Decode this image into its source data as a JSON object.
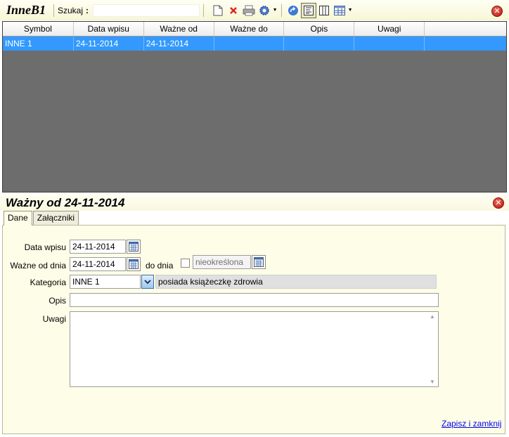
{
  "app": {
    "title": "InneB1"
  },
  "toolbar": {
    "search_label": "Szukaj",
    "search_colon": ":",
    "search_value": ""
  },
  "grid": {
    "columns": [
      "Symbol",
      "Data wpisu",
      "Ważne od",
      "Ważne do",
      "Opis",
      "Uwagi",
      ""
    ],
    "rows": [
      [
        "INNE 1",
        "24-11-2014",
        "24-11-2014",
        "",
        "",
        "",
        ""
      ]
    ]
  },
  "detail": {
    "title": "Ważny od 24-11-2014",
    "tabs": [
      {
        "label": "Dane",
        "active": true
      },
      {
        "label": "Załączniki",
        "active": false
      }
    ],
    "form": {
      "data_wpisu_label": "Data wpisu",
      "data_wpisu_value": "24-11-2014",
      "wazne_od_label": "Ważne od dnia",
      "wazne_od_value": "24-11-2014",
      "do_dnia_label": "do dnia",
      "do_dnia_value": "nieokreślona",
      "kategoria_label": "Kategoria",
      "kategoria_value": "INNE 1",
      "kategoria_desc": "posiada książeczkę zdrowia",
      "opis_label": "Opis",
      "opis_value": "",
      "uwagi_label": "Uwagi",
      "uwagi_value": ""
    },
    "save_label": "Zapisz i zamknij"
  },
  "colors": {
    "selection": "#3399ff",
    "grid_background": "#6d6d6d",
    "panel_background": "#fefee8",
    "link": "#0000ee"
  },
  "icons": [
    "new-document-icon",
    "delete-icon",
    "print-icon",
    "settings-gear-icon",
    "refresh-icon",
    "filter-view-icon",
    "columns-icon",
    "table-layout-icon",
    "close-icon",
    "calendar-icon",
    "chevron-down-icon"
  ]
}
